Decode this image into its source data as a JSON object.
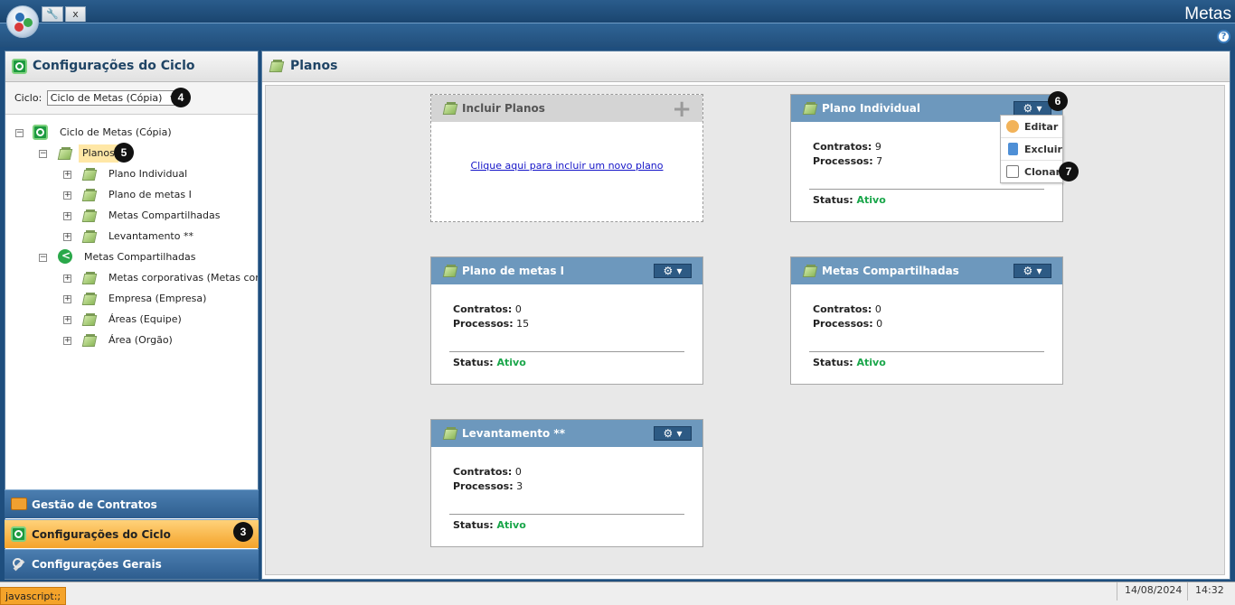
{
  "app": {
    "title": "Metas",
    "toolbar_close": "x",
    "help": "?"
  },
  "left_panel": {
    "title": "Configurações do Ciclo",
    "cycle_label": "Ciclo:",
    "cycle_value": "Ciclo de Metas (Cópia)",
    "tree": {
      "root": "Ciclo de Metas (Cópia)",
      "planos": "Planos",
      "planos_children": [
        "Plano Individual",
        "Plano de metas I",
        "Metas Compartilhadas",
        "Levantamento **"
      ],
      "metas": "Metas Compartilhadas",
      "metas_children": [
        "Metas corporativas (Metas corpora",
        "Empresa (Empresa)",
        "Áreas (Equipe)",
        "Área (Orgão)"
      ]
    }
  },
  "nav": {
    "items": [
      "Gestão de Contratos",
      "Configurações do Ciclo",
      "Configurações Gerais"
    ]
  },
  "main": {
    "title": "Planos",
    "add_card": {
      "title": "Incluir Planos",
      "link": "Clique aqui para incluir um novo plano"
    },
    "labels": {
      "contracts": "Contratos:",
      "processes": "Processos:",
      "status": "Status:"
    },
    "cards": [
      {
        "title": "Plano Individual",
        "contracts": "9",
        "processes": "7",
        "status": "Ativo"
      },
      {
        "title": "Plano de metas I",
        "contracts": "0",
        "processes": "15",
        "status": "Ativo"
      },
      {
        "title": "Metas Compartilhadas",
        "contracts": "0",
        "processes": "0",
        "status": "Ativo"
      },
      {
        "title": "Levantamento **",
        "contracts": "0",
        "processes": "3",
        "status": "Ativo"
      }
    ],
    "gear_menu": [
      "Editar",
      "Excluir",
      "Clonar"
    ]
  },
  "badges": [
    "3",
    "4",
    "5",
    "6",
    "7"
  ],
  "statusbar": {
    "tooltip": "javascript:;",
    "date": "14/08/2024",
    "time": "14:32"
  },
  "colors": {
    "active_status": "#1aa64a",
    "card_header": "#6d98bd",
    "nav_active": "#f4a32a"
  }
}
